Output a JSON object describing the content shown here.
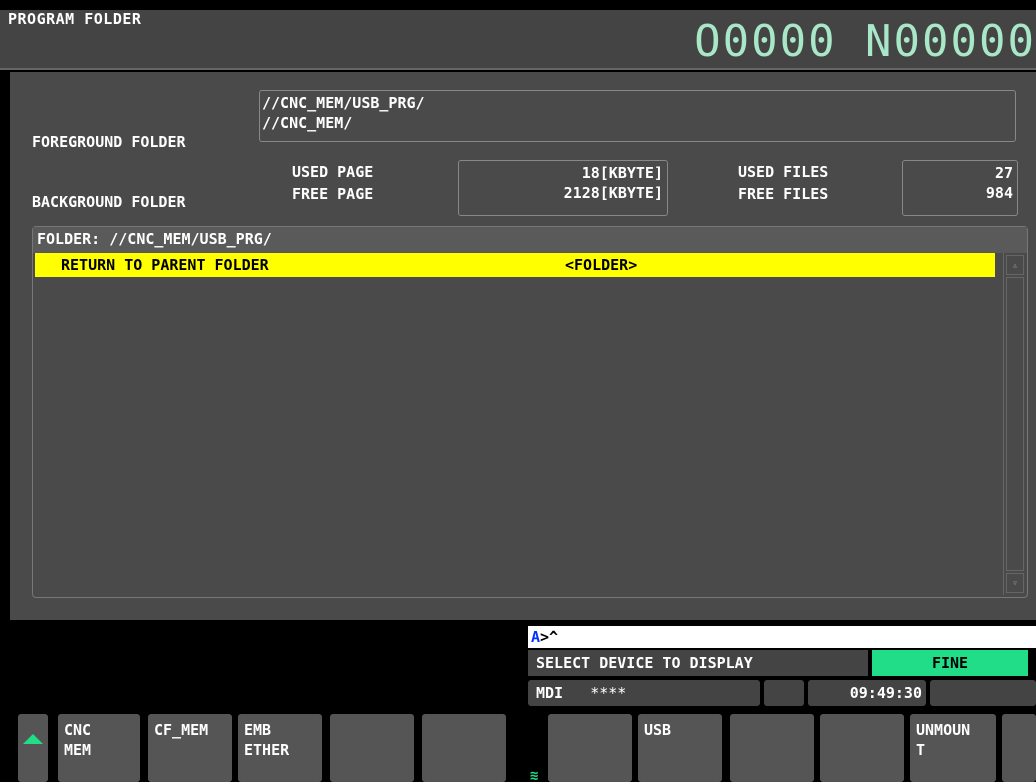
{
  "header": {
    "title": "PROGRAM FOLDER",
    "program_number": "O0000 N00000"
  },
  "folders": {
    "foreground_label": "FOREGROUND FOLDER",
    "foreground_path": "//CNC_MEM/USB_PRG/",
    "background_label": "BACKGROUND FOLDER",
    "background_path": "//CNC_MEM/"
  },
  "usage": {
    "used_page_label": "USED PAGE",
    "free_page_label": "FREE PAGE",
    "used_page_value": "18[KBYTE]",
    "free_page_value": "2128[KBYTE]",
    "used_files_label": "USED FILES",
    "free_files_label": "FREE FILES",
    "used_files_value": "27",
    "free_files_value": "984"
  },
  "list": {
    "header": "FOLDER: //CNC_MEM/USB_PRG/",
    "rows": [
      {
        "name": "RETURN TO PARENT FOLDER",
        "type": "<FOLDER>"
      }
    ]
  },
  "status": {
    "input_prefix": "A",
    "input_text": ">^",
    "message": "SELECT DEVICE TO DISPLAY",
    "state": "FINE",
    "mode": "MDI",
    "mode_status": "****",
    "clock": "09:49:30"
  },
  "softkeys": [
    {
      "label": "CNC\nMEM"
    },
    {
      "label": "CF_MEM"
    },
    {
      "label": "EMB\nETHER"
    },
    {
      "label": ""
    },
    {
      "label": ""
    },
    {
      "label": ""
    },
    {
      "label": "USB"
    },
    {
      "label": ""
    },
    {
      "label": ""
    },
    {
      "label": "UNMOUN\nT"
    }
  ],
  "colors": {
    "highlight": "#ffff00",
    "accent": "#22dd88",
    "program_number": "#a8e8c8"
  }
}
